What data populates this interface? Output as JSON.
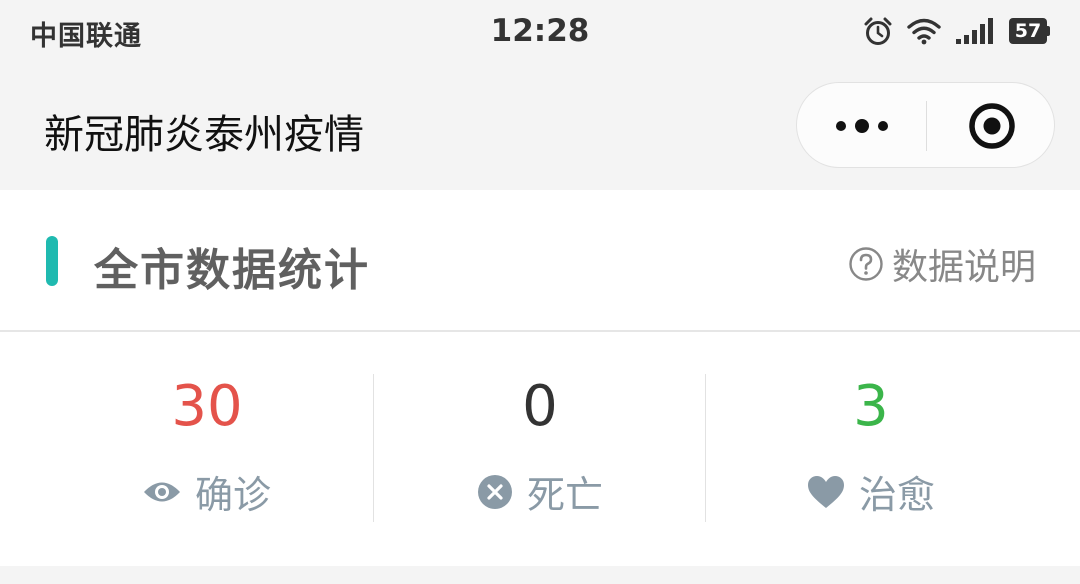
{
  "status_bar": {
    "carrier": "中国联通",
    "time": "12:28",
    "battery": "57",
    "icons": [
      "alarm-icon",
      "wifi-icon",
      "signal-icon",
      "battery-icon"
    ]
  },
  "nav": {
    "title": "新冠肺炎泰州疫情",
    "more_icon": "more-dots-icon",
    "close_icon": "close-target-icon"
  },
  "section": {
    "title": "全市数据统计",
    "help_label": "数据说明",
    "help_icon": "question-circle-icon",
    "accent_color": "#1fbab0"
  },
  "stats": [
    {
      "value": "30",
      "label": "确诊",
      "icon": "eye-icon",
      "color": "#e4534b"
    },
    {
      "value": "0",
      "label": "死亡",
      "icon": "x-circle-icon",
      "color": "#333333"
    },
    {
      "value": "3",
      "label": "治愈",
      "icon": "heart-icon",
      "color": "#3bb54a"
    }
  ]
}
